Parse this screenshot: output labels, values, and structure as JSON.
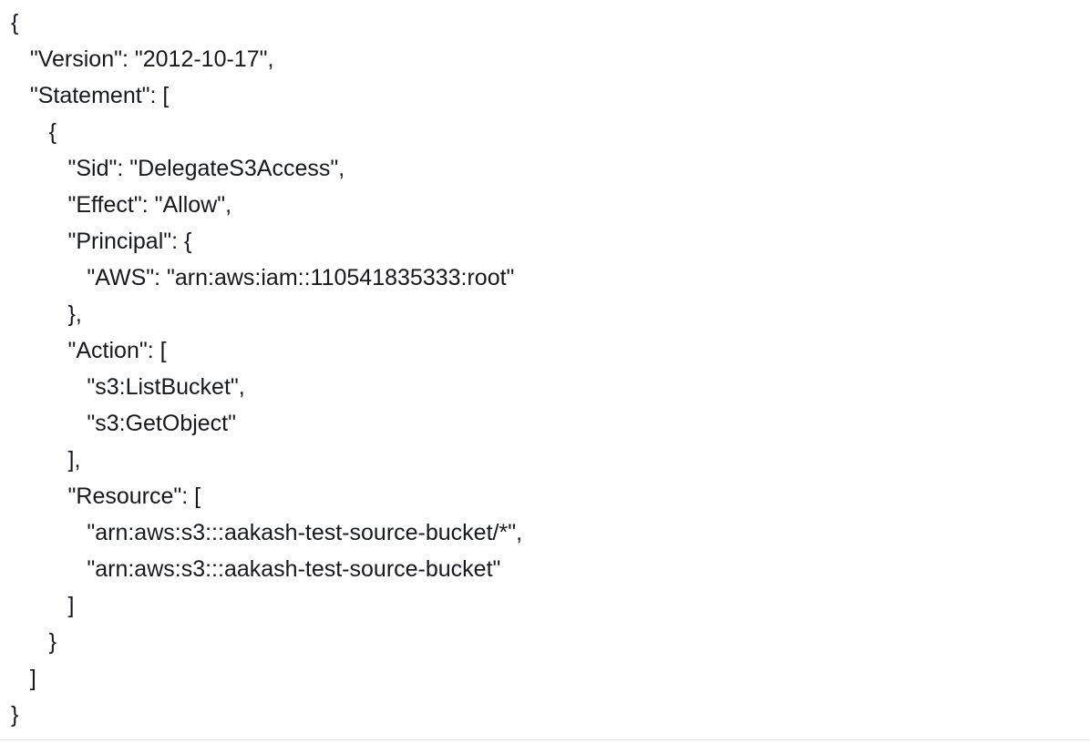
{
  "policy_document": {
    "lines": [
      "{",
      "   \"Version\": \"2012-10-17\",",
      "   \"Statement\": [",
      "      {",
      "         \"Sid\": \"DelegateS3Access\",",
      "         \"Effect\": \"Allow\",",
      "         \"Principal\": {",
      "            \"AWS\": \"arn:aws:iam::110541835333:root\"",
      "         },",
      "         \"Action\": [",
      "            \"s3:ListBucket\",",
      "            \"s3:GetObject\"",
      "         ],",
      "         \"Resource\": [",
      "            \"arn:aws:s3:::aakash-test-source-bucket/*\",",
      "            \"arn:aws:s3:::aakash-test-source-bucket\"",
      "         ]",
      "      }",
      "   ]",
      "}"
    ]
  }
}
